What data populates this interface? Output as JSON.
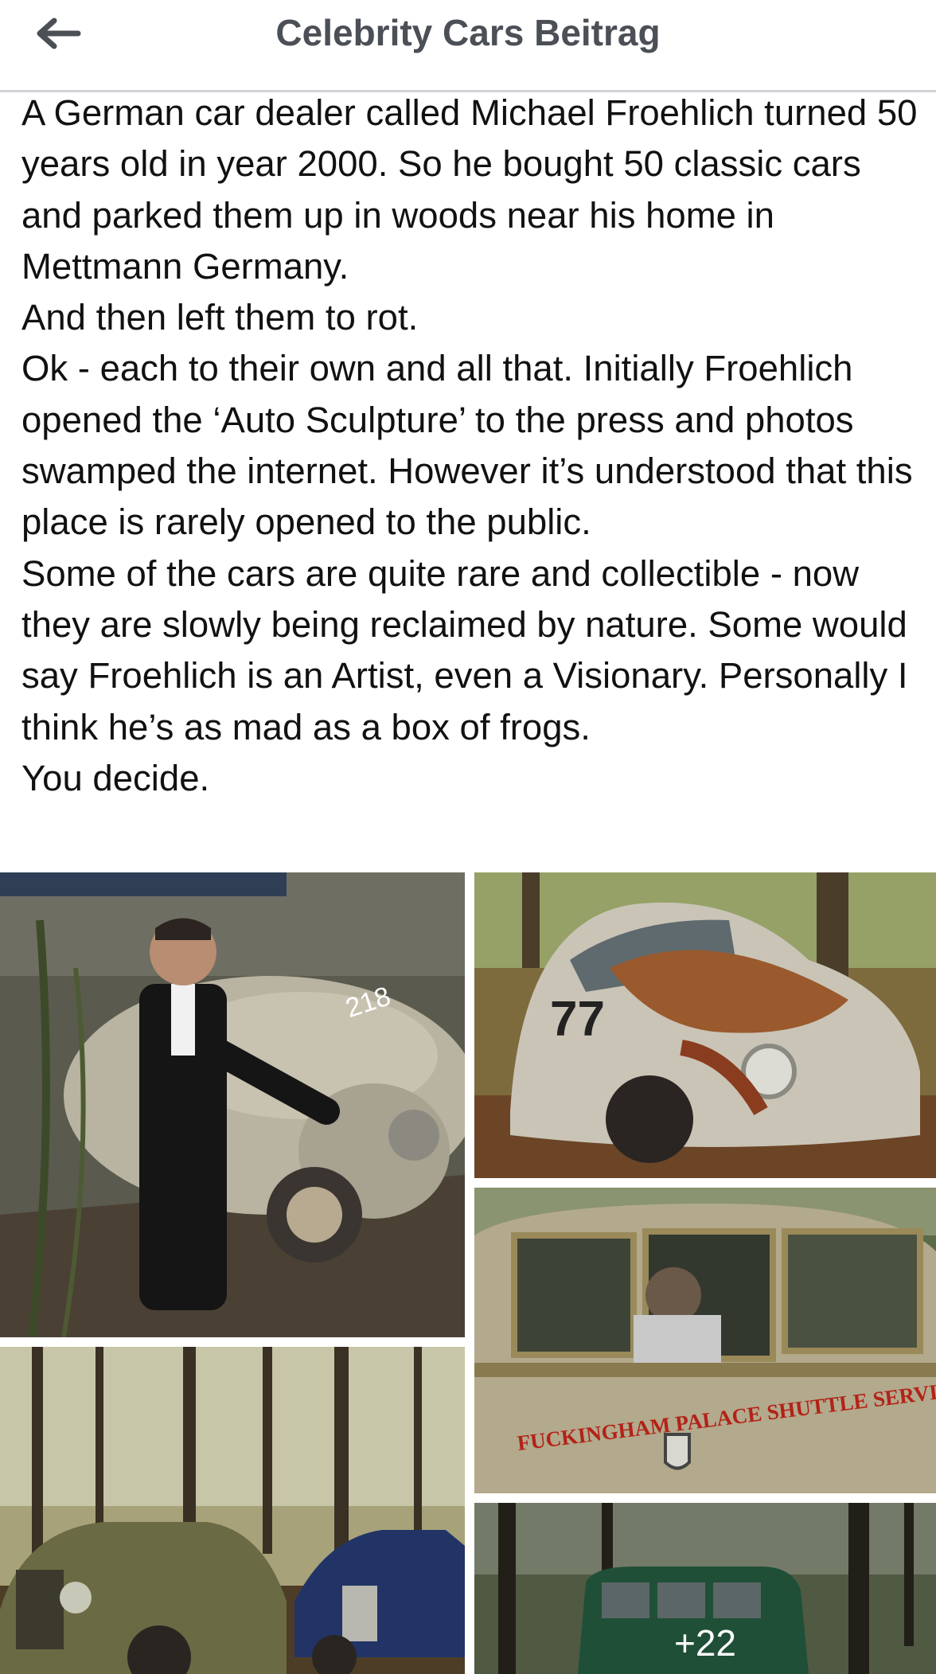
{
  "header": {
    "title": "Celebrity Cars Beitrag",
    "back_icon": "arrow-left-icon"
  },
  "post": {
    "paragraphs": [
      "A German car dealer called Michael Froehlich turned 50 years old in year 2000. So he bought 50 classic cars and parked them up in woods near his home in Mettmann Germany.",
      "And then left them to rot.",
      "Ok - each to their own and all that. Initially Froehlich opened the ‘Auto Sculpture’ to the press and photos swamped the internet. However it’s understood that this place is rarely opened to the public.",
      "Some of the cars are quite rare and collectible - now they are slowly being reclaimed by nature. Some would say Froehlich is an Artist, even a Visionary. Personally I think he’s as mad as a box of frogs.",
      "You decide."
    ]
  },
  "photos": {
    "photo1": {
      "car_number": "218"
    },
    "photo2": {
      "car_number": "77"
    },
    "photo4": {
      "sign_text": "FUCKINGHAM PALACE SHUTTLE SERVICE"
    },
    "photo5": {
      "more_count": "+22"
    }
  },
  "colors": {
    "title": "#4b4f56",
    "body_text": "#111111",
    "divider": "#d0d2d6"
  }
}
